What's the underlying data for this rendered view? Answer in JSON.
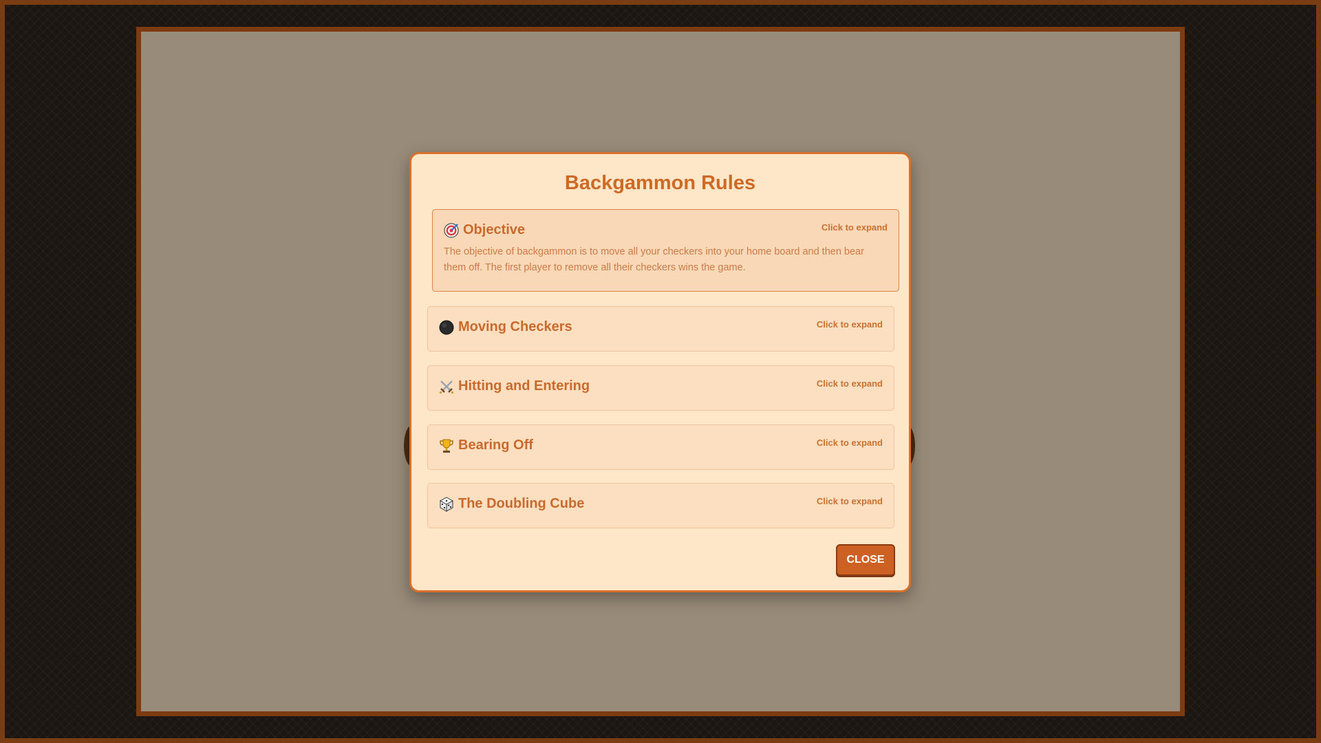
{
  "modal": {
    "title": "Backgammon Rules",
    "close_label": "CLOSE"
  },
  "sections": [
    {
      "icon": "target-icon",
      "title": "Objective",
      "hint": "Click to expand",
      "expanded": true,
      "body": "The objective of backgammon is to move all your checkers into your home board and then bear them off. The first player to remove all their checkers wins the game."
    },
    {
      "icon": "black-circle-icon",
      "title": "Moving Checkers",
      "hint": "Click to expand",
      "expanded": false
    },
    {
      "icon": "crossed-swords-icon",
      "title": "Hitting and Entering",
      "hint": "Click to expand",
      "expanded": false
    },
    {
      "icon": "trophy-icon",
      "title": "Bearing Off",
      "hint": "Click to expand",
      "expanded": false
    },
    {
      "icon": "dice-icon",
      "title": "The Doubling Cube",
      "hint": "Click to expand",
      "expanded": false
    }
  ],
  "colors": {
    "accent": "#cc6a26",
    "modal_bg": "#fee6c8",
    "section_bg": "#fcdfc0",
    "frame": "#7a3c12"
  }
}
